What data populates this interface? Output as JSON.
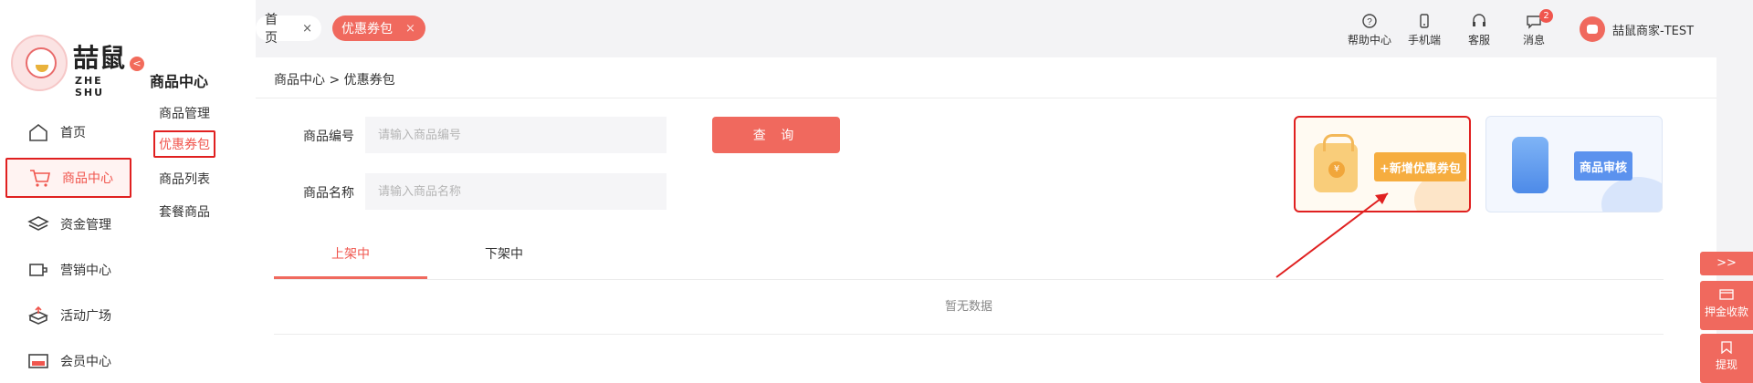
{
  "brand": {
    "name_cn": "喆鼠",
    "name_en": "ZHE SHU"
  },
  "nav": {
    "items": [
      {
        "label": "首页",
        "icon": "home-icon"
      },
      {
        "label": "商品中心",
        "icon": "cart-icon",
        "active": true
      },
      {
        "label": "资金管理",
        "icon": "layers-icon"
      },
      {
        "label": "营销中心",
        "icon": "marketing-icon"
      },
      {
        "label": "活动广场",
        "icon": "upload-box-icon"
      },
      {
        "label": "会员中心",
        "icon": "vip-icon"
      }
    ],
    "collapse_label": "<"
  },
  "subnav": {
    "title": "商品中心",
    "items": [
      {
        "label": "商品管理"
      },
      {
        "label": "优惠券包",
        "active": true
      },
      {
        "label": "商品列表"
      },
      {
        "label": "套餐商品"
      }
    ]
  },
  "tabs": {
    "home": {
      "label": "首页",
      "close": "×"
    },
    "coupon": {
      "label": "优惠券包",
      "close": "×"
    }
  },
  "toolbar": {
    "help": "帮助中心",
    "mobile": "手机端",
    "service": "客服",
    "messages": "消息",
    "message_count": "2",
    "user": "喆鼠商家-TEST"
  },
  "breadcrumb": "商品中心 > 优惠券包",
  "filters": {
    "code_label": "商品编号",
    "code_placeholder": "请输入商品编号",
    "name_label": "商品名称",
    "name_placeholder": "请输入商品名称",
    "query_button": "查 询"
  },
  "cards": {
    "add_label": "+新增优惠券包",
    "audit_label": "商品审核"
  },
  "status_tabs": [
    {
      "label": "上架中",
      "active": true
    },
    {
      "label": "下架中"
    }
  ],
  "empty_text": "暂无数据",
  "float_tools": {
    "toggle": ">>",
    "deposit": "押金收款",
    "withdraw": "提现"
  },
  "colors": {
    "accent": "#f0695e",
    "highlight_box": "#e02020",
    "add_button": "#f6ad3f",
    "audit_button": "#5b92ee"
  }
}
